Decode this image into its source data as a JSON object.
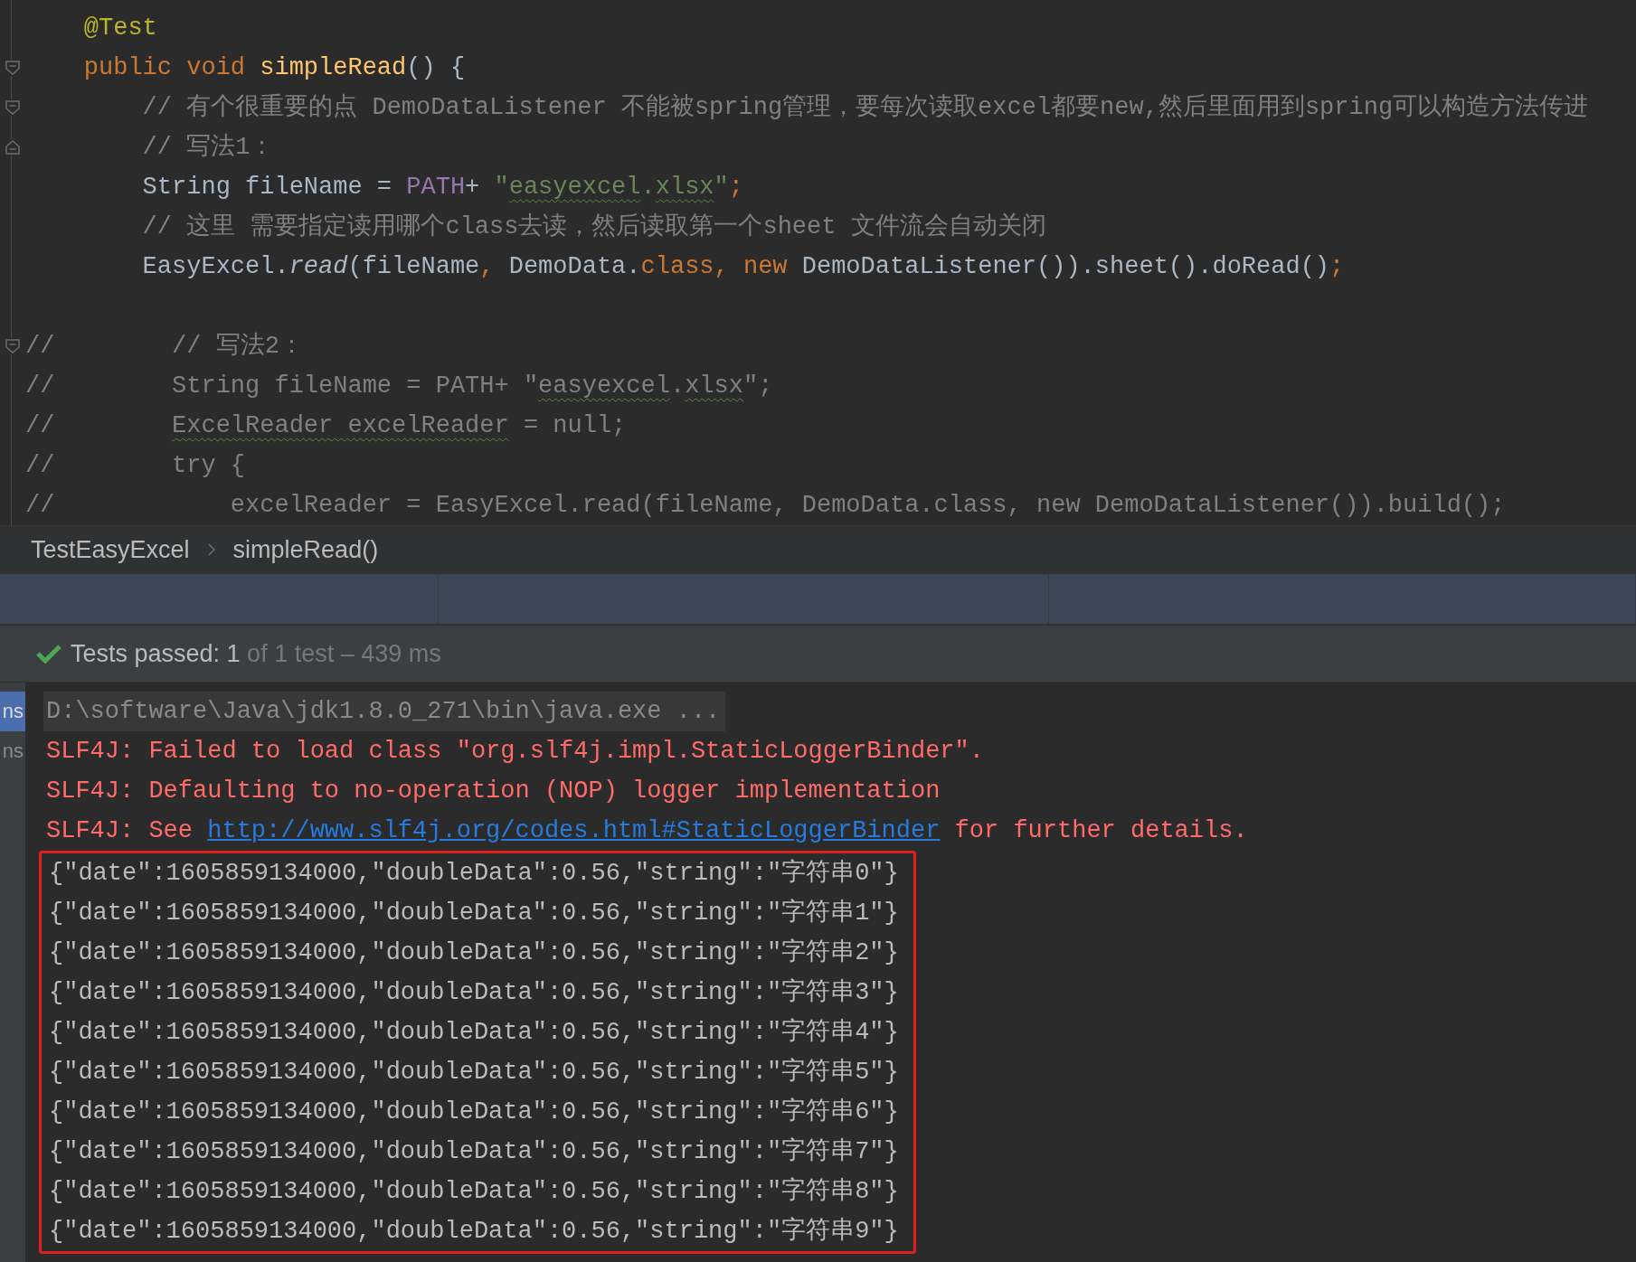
{
  "editor": {
    "lines": [
      {
        "kind": "code",
        "segments": [
          {
            "text": "    @Test",
            "kind": "annotation"
          }
        ]
      },
      {
        "kind": "code",
        "fold_start": true,
        "segments": [
          {
            "text": "    public void ",
            "kind": "keyword"
          },
          {
            "text": "simpleRead",
            "kind": "method"
          },
          {
            "text": "() {",
            "kind": "plain"
          }
        ]
      },
      {
        "kind": "code",
        "fold_start": true,
        "segments": [
          {
            "text": "        // 有个很重要的点 DemoDataListener 不能被spring管理，要每次读取excel都要new,然后里面用到spring可以构造方法传进",
            "kind": "comment"
          }
        ]
      },
      {
        "kind": "code",
        "fold_end": true,
        "segments": [
          {
            "text": "        // 写法1：",
            "kind": "comment"
          }
        ]
      },
      {
        "kind": "code",
        "segments": [
          {
            "text": "        String fileName = ",
            "kind": "plain"
          },
          {
            "text": "PATH",
            "kind": "constant"
          },
          {
            "text": "+ ",
            "kind": "plain"
          },
          {
            "text": "\"",
            "kind": "string"
          },
          {
            "text": "easyexcel",
            "kind": "string",
            "warning": true
          },
          {
            "text": ".",
            "kind": "string"
          },
          {
            "text": "xlsx",
            "kind": "string",
            "warning": true
          },
          {
            "text": "\"",
            "kind": "string"
          },
          {
            "text": ";",
            "kind": "keyword"
          }
        ]
      },
      {
        "kind": "code",
        "segments": [
          {
            "text": "        // 这里 需要指定读用哪个class去读，然后读取第一个sheet 文件流会自动关闭",
            "kind": "comment"
          }
        ]
      },
      {
        "kind": "code",
        "segments": [
          {
            "text": "        EasyExcel.",
            "kind": "plain"
          },
          {
            "text": "read",
            "kind": "static"
          },
          {
            "text": "(fileName",
            "kind": "plain"
          },
          {
            "text": ", ",
            "kind": "keyword"
          },
          {
            "text": "DemoData.",
            "kind": "plain"
          },
          {
            "text": "class",
            "kind": "keyword"
          },
          {
            "text": ", ",
            "kind": "keyword"
          },
          {
            "text": "new ",
            "kind": "keyword"
          },
          {
            "text": "DemoDataListener()).sheet().doRead()",
            "kind": "plain"
          },
          {
            "text": ";",
            "kind": "keyword"
          }
        ]
      },
      {
        "kind": "blank"
      },
      {
        "kind": "code",
        "fold_start": true,
        "segments": [
          {
            "text": "//        // 写法2：",
            "kind": "comment"
          }
        ]
      },
      {
        "kind": "code",
        "segments": [
          {
            "text": "//        String fileName = PATH+ \"",
            "kind": "comment"
          },
          {
            "text": "easyexcel",
            "kind": "comment",
            "warning": true
          },
          {
            "text": ".",
            "kind": "comment"
          },
          {
            "text": "xlsx",
            "kind": "comment",
            "warning": true
          },
          {
            "text": "\";",
            "kind": "comment"
          }
        ]
      },
      {
        "kind": "code",
        "segments": [
          {
            "text": "//        ",
            "kind": "comment"
          },
          {
            "text": "ExcelReader excelReader",
            "kind": "comment",
            "warning": true
          },
          {
            "text": " = null;",
            "kind": "comment"
          }
        ]
      },
      {
        "kind": "code",
        "segments": [
          {
            "text": "//        try {",
            "kind": "comment"
          }
        ]
      },
      {
        "kind": "code",
        "segments": [
          {
            "text": "//            excelReader = EasyExcel.read(fileName, DemoData.class, new DemoDataListener()).build();",
            "kind": "comment"
          }
        ]
      }
    ]
  },
  "breadcrumb": [
    "TestEasyExcel",
    "simpleRead()"
  ],
  "test_status": {
    "passed": true,
    "label": "Tests passed: 1",
    "detail": " of 1 test – 439 ms"
  },
  "console": {
    "side_tabs": [
      {
        "label": "ns",
        "selected": true
      },
      {
        "label": "ns",
        "selected": false
      }
    ],
    "lines": [
      {
        "kind": "command",
        "segments": [
          {
            "text": "D:\\software\\Java\\jdk1.8.0_271\\bin\\java.exe ..."
          }
        ]
      },
      {
        "kind": "error",
        "segments": [
          {
            "text": "SLF4J: Failed to load class \"org.slf4j.impl.StaticLoggerBinder\"."
          }
        ]
      },
      {
        "kind": "error",
        "segments": [
          {
            "text": "SLF4J: Defaulting to no-operation (NOP) logger implementation"
          }
        ]
      },
      {
        "kind": "error",
        "segments": [
          {
            "text": "SLF4J: See "
          },
          {
            "text": "http://www.slf4j.org/codes.html#StaticLoggerBinder",
            "link": true
          },
          {
            "text": " for further details."
          }
        ]
      }
    ],
    "framed_output": [
      "{\"date\":1605859134000,\"doubleData\":0.56,\"string\":\"字符串0\"}",
      "{\"date\":1605859134000,\"doubleData\":0.56,\"string\":\"字符串1\"}",
      "{\"date\":1605859134000,\"doubleData\":0.56,\"string\":\"字符串2\"}",
      "{\"date\":1605859134000,\"doubleData\":0.56,\"string\":\"字符串3\"}",
      "{\"date\":1605859134000,\"doubleData\":0.56,\"string\":\"字符串4\"}",
      "{\"date\":1605859134000,\"doubleData\":0.56,\"string\":\"字符串5\"}",
      "{\"date\":1605859134000,\"doubleData\":0.56,\"string\":\"字符串6\"}",
      "{\"date\":1605859134000,\"doubleData\":0.56,\"string\":\"字符串7\"}",
      "{\"date\":1605859134000,\"doubleData\":0.56,\"string\":\"字符串8\"}",
      "{\"date\":1605859134000,\"doubleData\":0.56,\"string\":\"字符串9\"}"
    ]
  }
}
